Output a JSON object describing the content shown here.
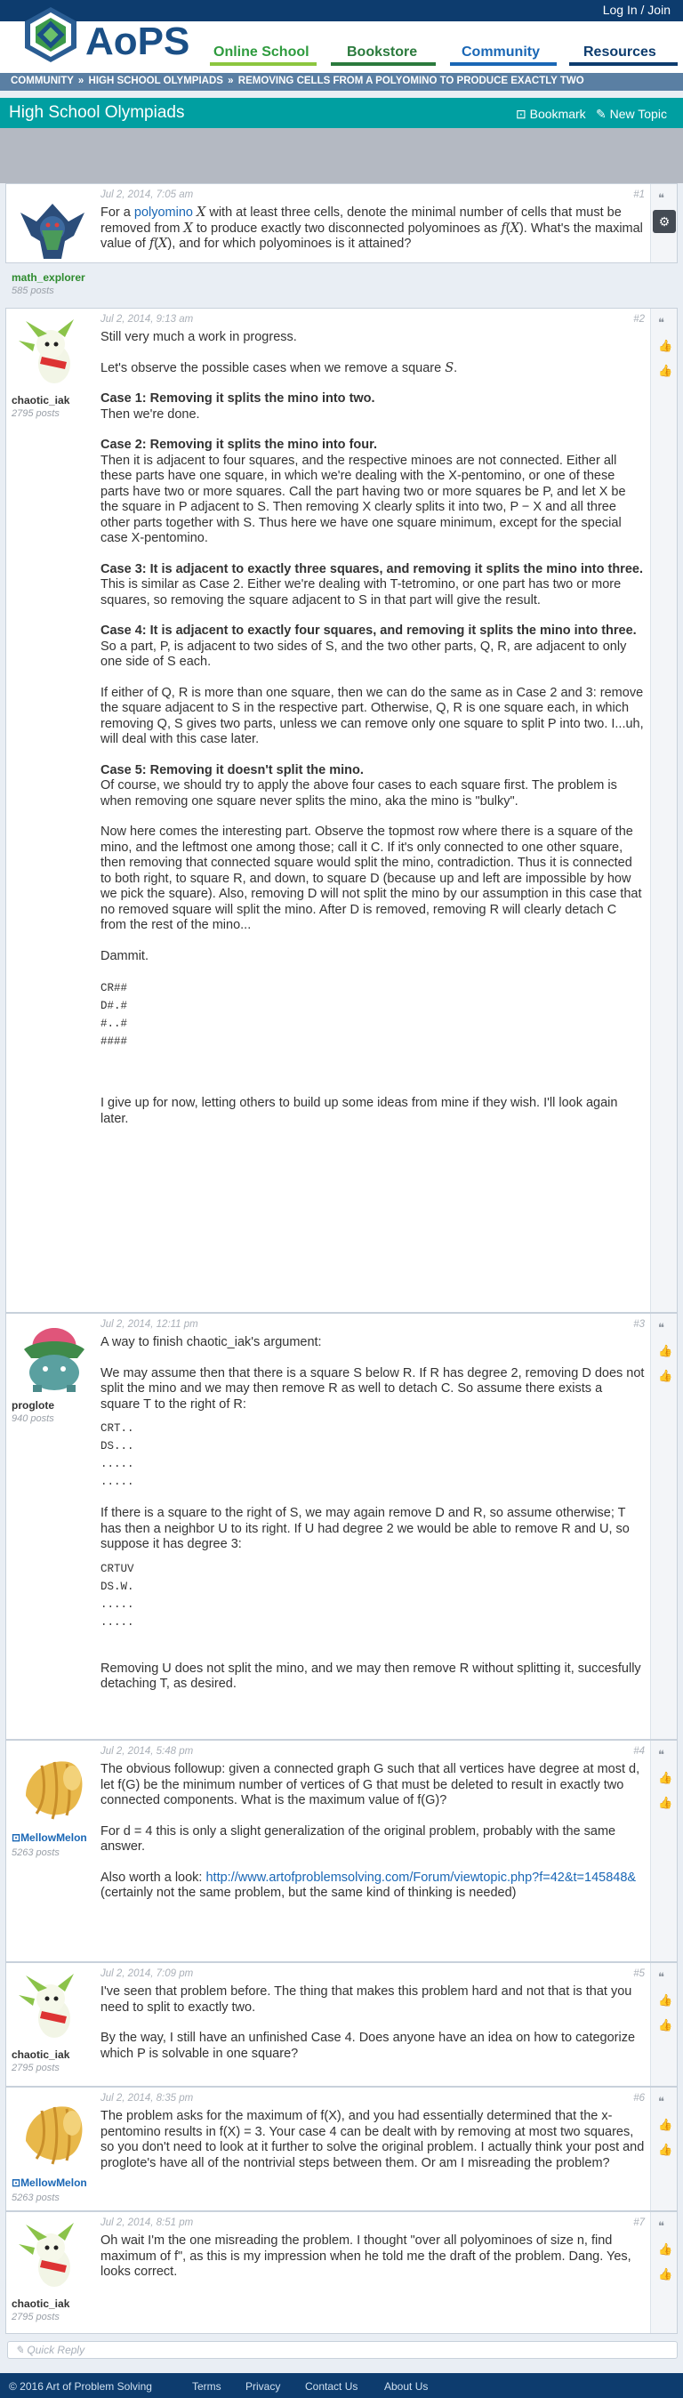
{
  "topbar": {
    "login": "Log In / Join"
  },
  "brand": {
    "logo_text": "AoPS"
  },
  "nav": [
    {
      "label": "Online School",
      "color": "#2e9b3e"
    },
    {
      "label": "Bookstore",
      "color": "#2b7a3d"
    },
    {
      "label": "Community",
      "color": "#1a67b5"
    },
    {
      "label": "Resources",
      "color": "#0d3c6e"
    }
  ],
  "breadcrumbs": [
    "COMMUNITY",
    "HIGH SCHOOL OLYMPIADS",
    "REMOVING CELLS FROM A POLYOMINO TO PRODUCE EXACTLY TWO"
  ],
  "forum": {
    "title": "High School Olympiads",
    "bookmark": "Bookmark",
    "new_topic": "New Topic"
  },
  "posts": [
    {
      "id": 1,
      "author": "math_explorer",
      "posts": "585 posts",
      "date": "Jul 2, 2014, 7:05 am",
      "num": "#1"
    },
    {
      "id": 2,
      "author": "chaotic_iak",
      "posts": "2795 posts",
      "date": "Jul 2, 2014, 9:13 am",
      "num": "#2"
    },
    {
      "id": 3,
      "author": "proglote",
      "posts": "940 posts",
      "date": "Jul 2, 2014, 12:11 pm",
      "num": "#3"
    },
    {
      "id": 4,
      "author": "MellowMelon",
      "posts": "5263 posts",
      "date": "Jul 2, 2014, 5:48 pm",
      "num": "#4"
    },
    {
      "id": 5,
      "author": "chaotic_iak",
      "posts": "2795 posts",
      "date": "Jul 2, 2014, 7:09 pm",
      "num": "#5"
    },
    {
      "id": 6,
      "author": "MellowMelon",
      "posts": "5263 posts",
      "date": "Jul 2, 2014, 8:35 pm",
      "num": "#6"
    },
    {
      "id": 7,
      "author": "chaotic_iak",
      "posts": "2795 posts",
      "date": "Jul 2, 2014, 8:51 pm",
      "num": "#7"
    }
  ],
  "p1": {
    "a": "For a",
    "link": "polyomino",
    "b": "with at least three cells, denote the minimal number of cells that must be removed from",
    "c": "to produce exactly two disconnected polyominoes as",
    "d": ". What's the maximal value of",
    "e": ", and for which polyominoes is it attained?"
  },
  "p2": {
    "l1": "Still very much a work in progress.",
    "l2": "Let's observe the possible cases when we remove a square",
    "c1h": "Case 1: Removing it splits the mino into two.",
    "c1": "Then we're done.",
    "c2h": "Case 2: Removing it splits the mino into four.",
    "c2": "Then it is adjacent to four squares, and the respective minoes are not connected. Either all these parts have one square, in which we're dealing with the X-pentomino, or one of these parts have two or more squares. Call the part having two or more squares be P, and let X be the square in P adjacent to S. Then removing X clearly splits it into two, P − X and all three other parts together with S. Thus here we have one square minimum, except for the special case X-pentomino.",
    "c3h": "Case 3: It is adjacent to exactly three squares, and removing it splits the mino into three.",
    "c3": "This is similar as Case 2. Either we're dealing with T-tetromino, or one part has two or more squares, so removing the square adjacent to S in that part will give the result.",
    "c4h": "Case 4: It is adjacent to exactly four squares, and removing it splits the mino into three.",
    "c4": "So a part, P, is adjacent to two sides of S, and the two other parts, Q, R, are adjacent to only one side of S each.",
    "c4b": "If either of Q, R is more than one square, then we can do the same as in Case 2 and 3: remove the square adjacent to S in the respective part. Otherwise, Q, R is one square each, in which removing Q, S gives two parts, unless we can remove only one square to split P into two. I...uh, will deal with this case later.",
    "c5h": "Case 5: Removing it doesn't split the mino.",
    "c5": "Of course, we should try to apply the above four cases to each square first. The problem is when removing one square never splits the mino, aka the mino is \"bulky\".",
    "c6": "Now here comes the interesting part. Observe the topmost row where there is a square of the mino, and the leftmost one among those; call it C. If it's only connected to one other square, then removing that connected square would split the mino, contradiction. Thus it is connected to both right, to square R, and down, to square D (because up and left are impossible by how we pick the square). Also, removing D will not split the mino by our assumption in this case that no removed square will split the mino. After D is removed, removing R will clearly detach C from the rest of the mino...",
    "dammit": "Dammit.",
    "grid": "CR##\nD#.#\n#..#\n####",
    "end": "I give up for now, letting others to build up some ideas from mine if they wish. I'll look again later."
  },
  "p3": {
    "l1": "A way to finish chaotic_iak's argument:",
    "l2": "We may assume then that there is a square S below R. If R has degree 2, removing D does not split the mino and we may then remove R as well to detach C. So assume there exists a square T to the right of R:",
    "g1": "CRT..\nDS...\n.....\n.....",
    "l3": "If there is a square to the right of S, we may again remove D and R, so assume otherwise; T has then a neighbor U to its right. If U had degree 2 we would be able to remove R and U, so suppose it has degree 3:",
    "g2": "CRTUV\nDS.W.\n.....\n.....",
    "l4": "Removing U does not split the mino, and we may then remove R without splitting it, succesfully detaching T, as desired."
  },
  "p4": {
    "l1": "The obvious followup: given a connected graph G such that all vertices have degree at most d, let f(G) be the minimum number of vertices of G that must be deleted to result in exactly two connected components. What is the maximum value of f(G)?",
    "l2": "For d = 4 this is only a slight generalization of the original problem, probably with the same answer.",
    "l3a": "Also worth a look:",
    "link": "http://www.artofproblemsolving.com/Forum/viewtopic.php?f=42&t=145848&",
    "l3b": "(certainly not the same problem, but the same kind of thinking is needed)"
  },
  "p5": {
    "l1": "I've seen that problem before. The thing that makes this problem hard and not that is that you need to split to exactly two.",
    "l2": "By the way, I still have an unfinished Case 4. Does anyone have an idea on how to categorize which P is solvable in one square?"
  },
  "p6": {
    "l1": "The problem asks for the maximum of f(X), and you had essentially determined that the x-pentomino results in f(X) = 3. Your case 4 can be dealt with by removing at most two squares, so you don't need to look at it further to solve the original problem. I actually think your post and proglote's have all of the nontrivial steps between them. Or am I misreading the problem?"
  },
  "p7": {
    "l1": "Oh wait I'm the one misreading the problem. I thought \"over all polyominoes of size n, find maximum of f\", as this is my impression when he told me the draft of the problem. Dang. Yes, looks correct."
  },
  "reply": {
    "placeholder": "Quick Reply"
  },
  "footer": {
    "copyright": "© 2016 Art of Problem Solving",
    "links": [
      "Terms",
      "Privacy",
      "Contact Us",
      "About Us"
    ]
  }
}
